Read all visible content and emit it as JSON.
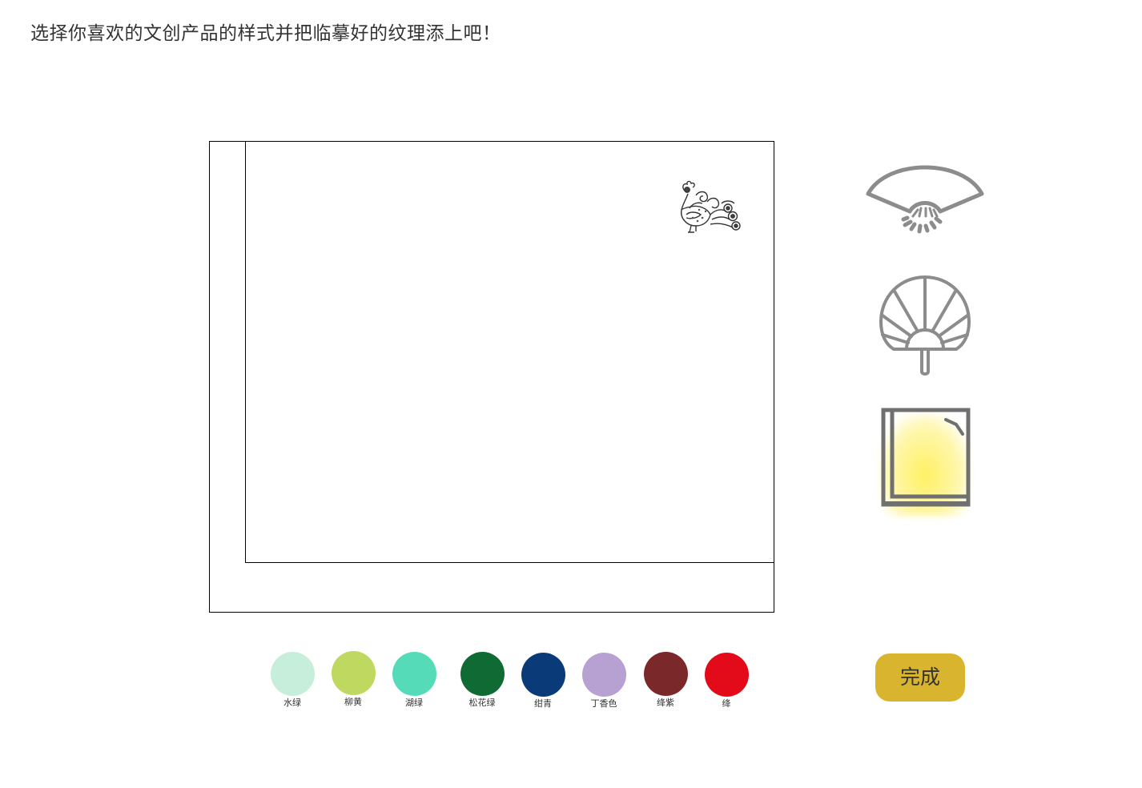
{
  "instruction": "选择你喜欢的文创产品的样式并把临摹好的纹理添上吧！",
  "canvas": {
    "pattern_icon": "phoenix-pattern-icon"
  },
  "styles": [
    {
      "id": "folding-fan",
      "icon": "folding-fan-icon",
      "selected": false
    },
    {
      "id": "round-fan",
      "icon": "round-fan-icon",
      "selected": false
    },
    {
      "id": "notebook",
      "icon": "notebook-icon",
      "selected": true
    }
  ],
  "palette": [
    {
      "name": "水绿",
      "color": "#c7eedb"
    },
    {
      "name": "柳黄",
      "color": "#bfd960"
    },
    {
      "name": "湖绿",
      "color": "#55dbb7"
    },
    {
      "name": "松花绿",
      "color": "#0f6a33"
    },
    {
      "name": "绀青",
      "color": "#0b3a78"
    },
    {
      "name": "丁香色",
      "color": "#b7a0d2"
    },
    {
      "name": "绛紫",
      "color": "#7b282b"
    },
    {
      "name": "绛",
      "color": "#e30b19"
    }
  ],
  "done_label": "完成",
  "accent_color": "#d8b42f",
  "highlight_color": "#fff15a"
}
